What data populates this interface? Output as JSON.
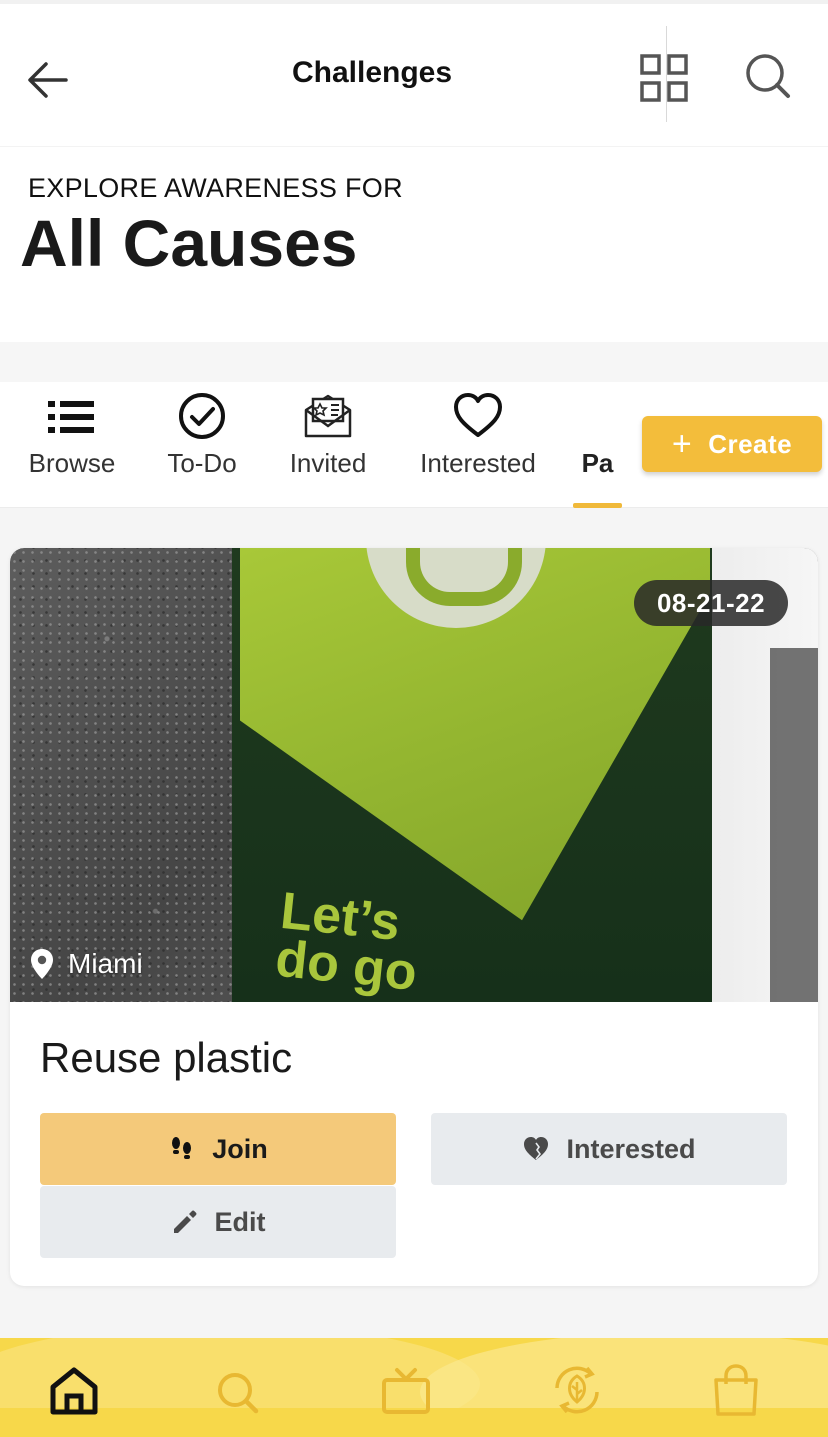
{
  "header": {
    "title": "Challenges",
    "icons": [
      "back-arrow-icon",
      "grid-view-icon",
      "search-icon"
    ]
  },
  "hero": {
    "kicker": "EXPLORE AWARENESS FOR",
    "heading": "All Causes"
  },
  "tabs": {
    "items": [
      {
        "label": "Browse",
        "icon": "list-icon"
      },
      {
        "label": "To-Do",
        "icon": "check-circle-icon"
      },
      {
        "label": "Invited",
        "icon": "invitation-envelope-icon"
      },
      {
        "label": "Interested",
        "icon": "heart-icon"
      },
      {
        "label": "Pa",
        "icon": "",
        "active": true
      }
    ],
    "create_label": "Create"
  },
  "card": {
    "date": "08-21-22",
    "location": "Miami",
    "image_text": "Let's\ndo go",
    "title": "Reuse plastic",
    "join_label": "Join",
    "interested_label": "Interested",
    "edit_label": "Edit"
  },
  "bottom_nav": {
    "items": [
      "home-icon",
      "search-icon",
      "tv-icon",
      "eco-recycle-icon",
      "shopping-bag-icon"
    ],
    "active": "home-icon"
  },
  "colors": {
    "accent": "#f3bd3b",
    "join_button": "#f4c97a",
    "secondary_button": "#e8ebee",
    "bottom_nav": "#f7d84a"
  }
}
